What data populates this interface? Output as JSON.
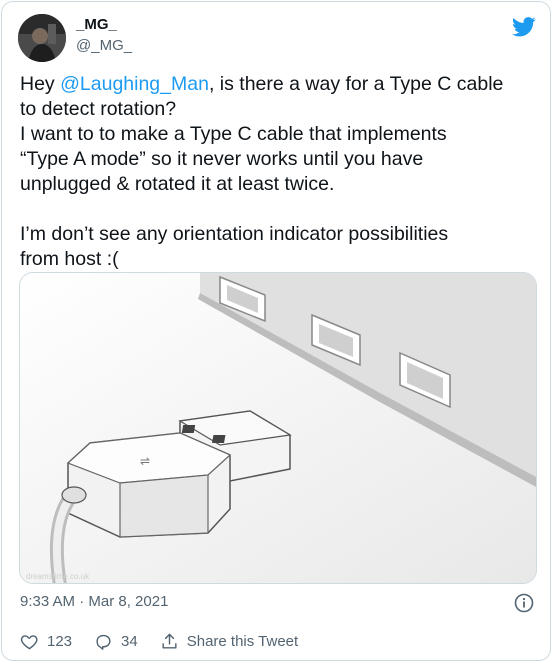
{
  "author": {
    "display_name": "_MG_",
    "handle": "@_MG_"
  },
  "tweet": {
    "line1_prefix": "Hey ",
    "mention": "@Laughing_Man",
    "line1_suffix": ", is there a way for a Type C cable\nto detect rotation?\nI want to to make a Type C cable that implements\n“Type A mode” so it never works until you have\nunplugged & rotated it at least twice.\n\nI’m don’t see any orientation indicator possibilities\nfrom host :("
  },
  "media": {
    "watermark": "dreamstime.co.uk"
  },
  "meta": {
    "timestamp": "9:33 AM · Mar 8, 2021"
  },
  "actions": {
    "likes": "123",
    "replies": "34",
    "share_label": "Share this Tweet"
  },
  "colors": {
    "accent": "#1d9bf0",
    "secondary_text": "#536471",
    "border": "#cfd9de"
  }
}
